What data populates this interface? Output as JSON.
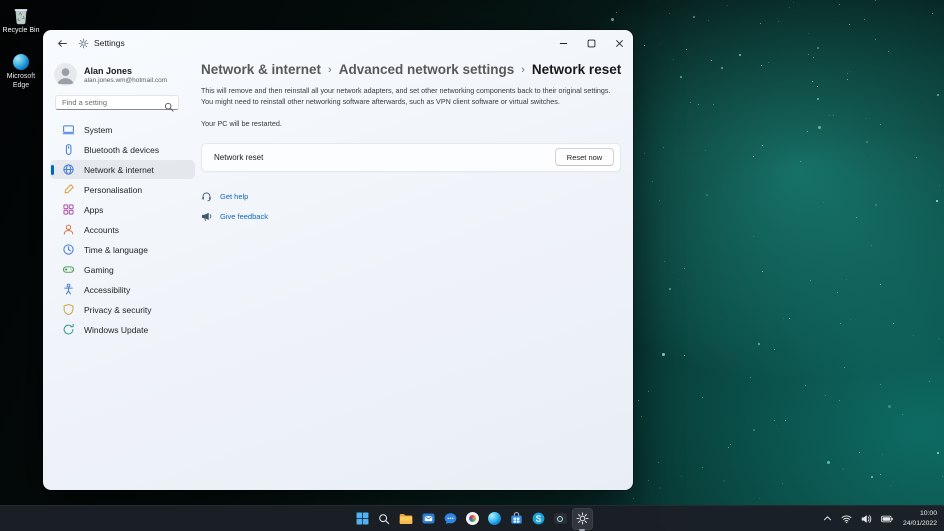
{
  "colors": {
    "accent": "#0067c0",
    "link": "#0d66c2",
    "taskbar_bg": "#1b1f26"
  },
  "desktop": {
    "icons": [
      {
        "name": "recycle-bin",
        "label": "Recycle Bin"
      },
      {
        "name": "microsoft-edge",
        "label": "Microsoft Edge"
      }
    ]
  },
  "window": {
    "titlebar": {
      "title": "Settings"
    },
    "user": {
      "name": "Alan Jones",
      "email": "alan.jones.wm@hotmail.com"
    },
    "search": {
      "placeholder": "Find a setting"
    },
    "sidebar": {
      "items": [
        {
          "label": "System",
          "icon": "system-icon",
          "icon_color": "#4a7fd6",
          "selected": false
        },
        {
          "label": "Bluetooth & devices",
          "icon": "bluetooth-devices-icon",
          "icon_color": "#4a7fd6",
          "selected": false
        },
        {
          "label": "Network & internet",
          "icon": "network-internet-icon",
          "icon_color": "#4a7fd6",
          "selected": true
        },
        {
          "label": "Personalisation",
          "icon": "personalisation-icon",
          "icon_color": "#d8a23c",
          "selected": false
        },
        {
          "label": "Apps",
          "icon": "apps-icon",
          "icon_color": "#b65ab0",
          "selected": false
        },
        {
          "label": "Accounts",
          "icon": "accounts-icon",
          "icon_color": "#d87a4a",
          "selected": false
        },
        {
          "label": "Time & language",
          "icon": "time-language-icon",
          "icon_color": "#4a7fd6",
          "selected": false
        },
        {
          "label": "Gaming",
          "icon": "gaming-icon",
          "icon_color": "#58a05a",
          "selected": false
        },
        {
          "label": "Accessibility",
          "icon": "accessibility-icon",
          "icon_color": "#4a7fd6",
          "selected": false
        },
        {
          "label": "Privacy & security",
          "icon": "privacy-security-icon",
          "icon_color": "#c9ab46",
          "selected": false
        },
        {
          "label": "Windows Update",
          "icon": "windows-update-icon",
          "icon_color": "#3f9e95",
          "selected": false
        }
      ]
    },
    "breadcrumb": {
      "separator": "›",
      "items": [
        "Network & internet",
        "Advanced network settings",
        "Network reset"
      ]
    },
    "content": {
      "description": "This will remove and then reinstall all your network adapters, and set other networking components back to their original settings. You might need to reinstall other networking software afterwards, such as VPN client software or virtual switches.",
      "restart_note": "Your PC will be restarted.",
      "card": {
        "label": "Network reset",
        "button_label": "Reset now"
      },
      "links": [
        {
          "label": "Get help",
          "icon": "get-help-icon"
        },
        {
          "label": "Give feedback",
          "icon": "feedback-icon"
        }
      ]
    }
  },
  "taskbar": {
    "icons": [
      {
        "name": "start",
        "active": false
      },
      {
        "name": "search",
        "active": false
      },
      {
        "name": "file-explorer",
        "active": false
      },
      {
        "name": "mail",
        "active": false
      },
      {
        "name": "chat",
        "active": false
      },
      {
        "name": "photos",
        "active": false
      },
      {
        "name": "edge",
        "active": false
      },
      {
        "name": "store",
        "active": false
      },
      {
        "name": "skype",
        "active": false
      },
      {
        "name": "camera",
        "active": false
      },
      {
        "name": "settings",
        "active": true
      }
    ],
    "tray": {
      "icon_names": [
        "hidden-icons-chevron",
        "wifi",
        "volume",
        "battery"
      ],
      "time": "10:00",
      "date": "24/01/2022"
    }
  }
}
